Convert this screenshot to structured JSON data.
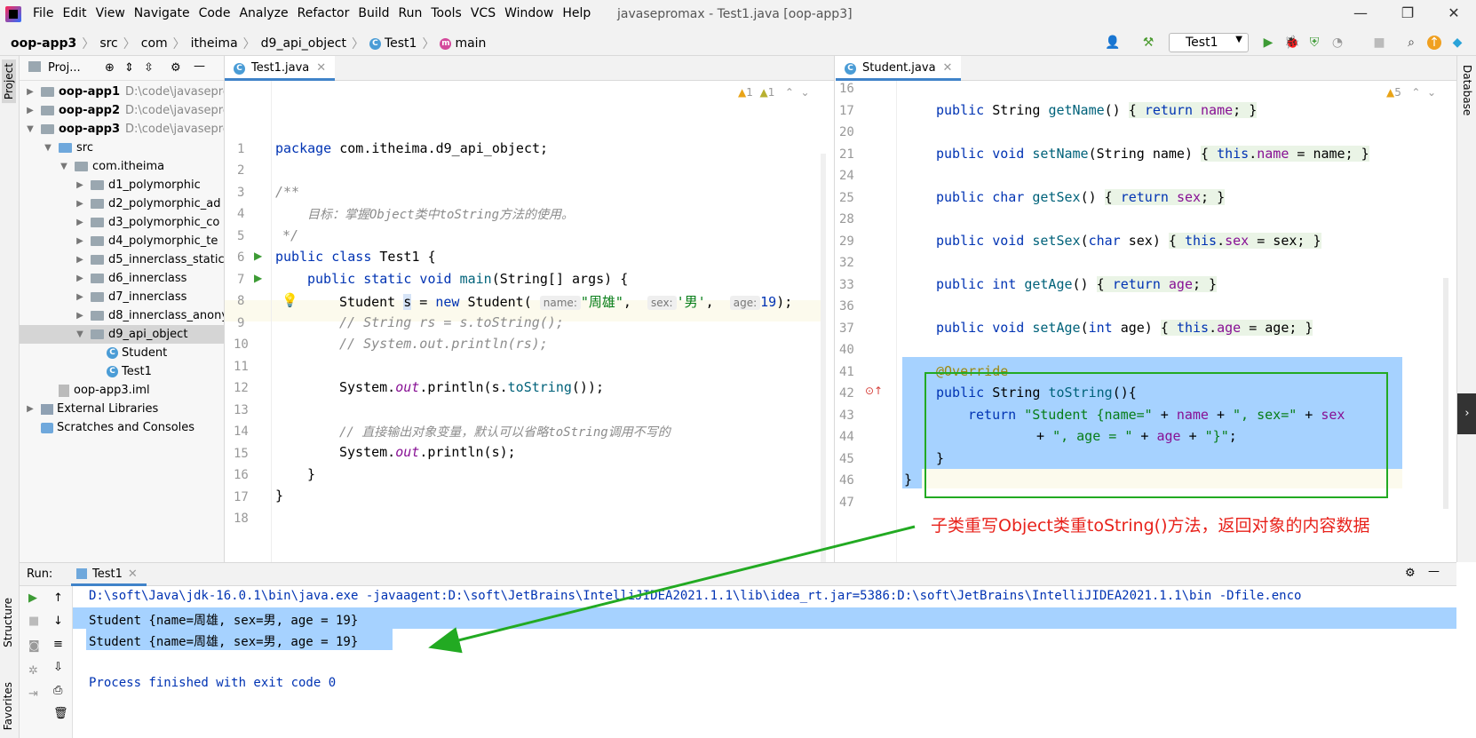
{
  "window": {
    "title": "javasepromax - Test1.java [oop-app3]",
    "menu": [
      "File",
      "Edit",
      "View",
      "Navigate",
      "Code",
      "Analyze",
      "Refactor",
      "Build",
      "Run",
      "Tools",
      "VCS",
      "Window",
      "Help"
    ]
  },
  "breadcrumb": [
    "oop-app3",
    "src",
    "com",
    "itheima",
    "d9_api_object",
    "Test1",
    "main"
  ],
  "toolbar": {
    "run_config": "Test1"
  },
  "side_tabs": {
    "project": "Project",
    "structure": "Structure",
    "favorites": "Favorites",
    "database": "Database"
  },
  "project": {
    "title": "Proj...",
    "tree": [
      {
        "label": "oop-app1",
        "path": "D:\\code\\javasepro",
        "bold": true
      },
      {
        "label": "oop-app2",
        "path": "D:\\code\\javasepro",
        "bold": true
      },
      {
        "label": "oop-app3",
        "path": "D:\\code\\javasepro",
        "bold": true
      },
      {
        "label": "src"
      },
      {
        "label": "com.itheima"
      },
      {
        "label": "d1_polymorphic"
      },
      {
        "label": "d2_polymorphic_ad"
      },
      {
        "label": "d3_polymorphic_co"
      },
      {
        "label": "d4_polymorphic_te"
      },
      {
        "label": "d5_innerclass_static"
      },
      {
        "label": "d6_innerclass"
      },
      {
        "label": "d7_innerclass"
      },
      {
        "label": "d8_innerclass_anony"
      },
      {
        "label": "d9_api_object"
      },
      {
        "label": "Student"
      },
      {
        "label": "Test1"
      },
      {
        "label": "oop-app3.iml"
      },
      {
        "label": "External Libraries"
      },
      {
        "label": "Scratches and Consoles"
      }
    ]
  },
  "editor1": {
    "tab": "Test1.java",
    "inspections": [
      "1",
      "1"
    ],
    "line_numbers": [
      "1",
      "2",
      "3",
      "4",
      "5",
      "6",
      "7",
      "8",
      "9",
      "10",
      "11",
      "12",
      "13",
      "14",
      "15",
      "16",
      "17",
      "18"
    ],
    "comment_text": "目标：掌握Object类中toString方法的使用。",
    "comment2_text": "// 直接输出对象变量，默认可以省略toString调用不写的",
    "hint_name": "name:",
    "hint_sex": "sex:",
    "hint_age": "age:"
  },
  "editor2": {
    "tab": "Student.java",
    "inspections": "5",
    "line_numbers": [
      "16",
      "17",
      "20",
      "21",
      "24",
      "25",
      "28",
      "29",
      "32",
      "33",
      "36",
      "37",
      "40",
      "41",
      "42",
      "43",
      "44",
      "45",
      "46",
      "47"
    ]
  },
  "run": {
    "label": "Run:",
    "tab": "Test1",
    "command": "D:\\soft\\Java\\jdk-16.0.1\\bin\\java.exe -javaagent:D:\\soft\\JetBrains\\IntelliJIDEA2021.1.1\\lib\\idea_rt.jar=5386:D:\\soft\\JetBrains\\IntelliJIDEA2021.1.1\\bin -Dfile.enco",
    "output1": "Student {name=周雄, sex=男, age = 19}",
    "output2": "Student {name=周雄, sex=男, age = 19}",
    "exit": "Process finished with exit code 0"
  },
  "annotation": {
    "note": "子类重写Object类重toString()方法，返回对象的内容数据",
    "box_color": "#22aa22",
    "note_color": "#e8221b"
  }
}
